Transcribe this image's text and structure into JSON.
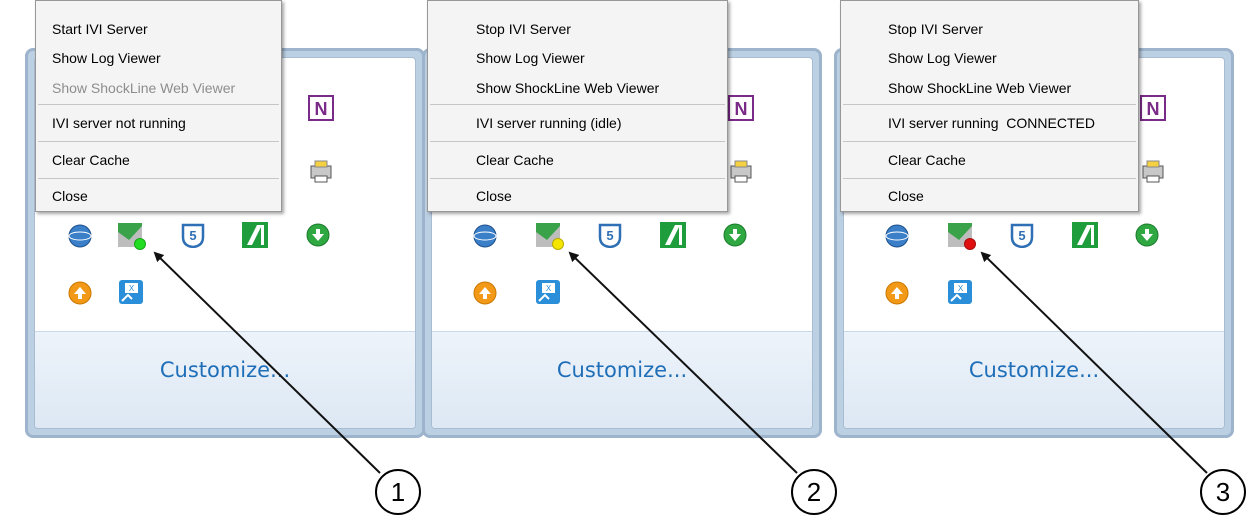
{
  "panels": [
    {
      "menu_items": [
        "Start IVI Server",
        "Show Log Viewer",
        "Show ShockLine Web Viewer",
        "IVI server not running",
        "Clear Cache",
        "Close"
      ],
      "status_color": "#22dd22",
      "customize": "Customize...",
      "callout": "1"
    },
    {
      "menu_items": [
        "Stop IVI Server",
        "Show Log Viewer",
        "Show ShockLine Web Viewer",
        "IVI server running (idle)",
        "Clear Cache",
        "Close"
      ],
      "status_color": "#f5e600",
      "customize": "Customize...",
      "callout": "2"
    },
    {
      "menu_items": [
        "Stop IVI Server",
        "Show Log Viewer",
        "Show ShockLine Web Viewer",
        "IVI server running  CONNECTED",
        "Clear Cache",
        "Close"
      ],
      "status_color": "#e01010",
      "customize": "Customize...",
      "callout": "3"
    }
  ],
  "icons": [
    "onenote-icon",
    "printer-icon",
    "globe-icon",
    "shockline-icon",
    "s5-icon",
    "green-slash-icon",
    "download-icon",
    "upload-icon",
    "excel-tool-icon"
  ],
  "colors": {
    "link": "#1e6eb8",
    "disabled": "#8d8d8d"
  }
}
